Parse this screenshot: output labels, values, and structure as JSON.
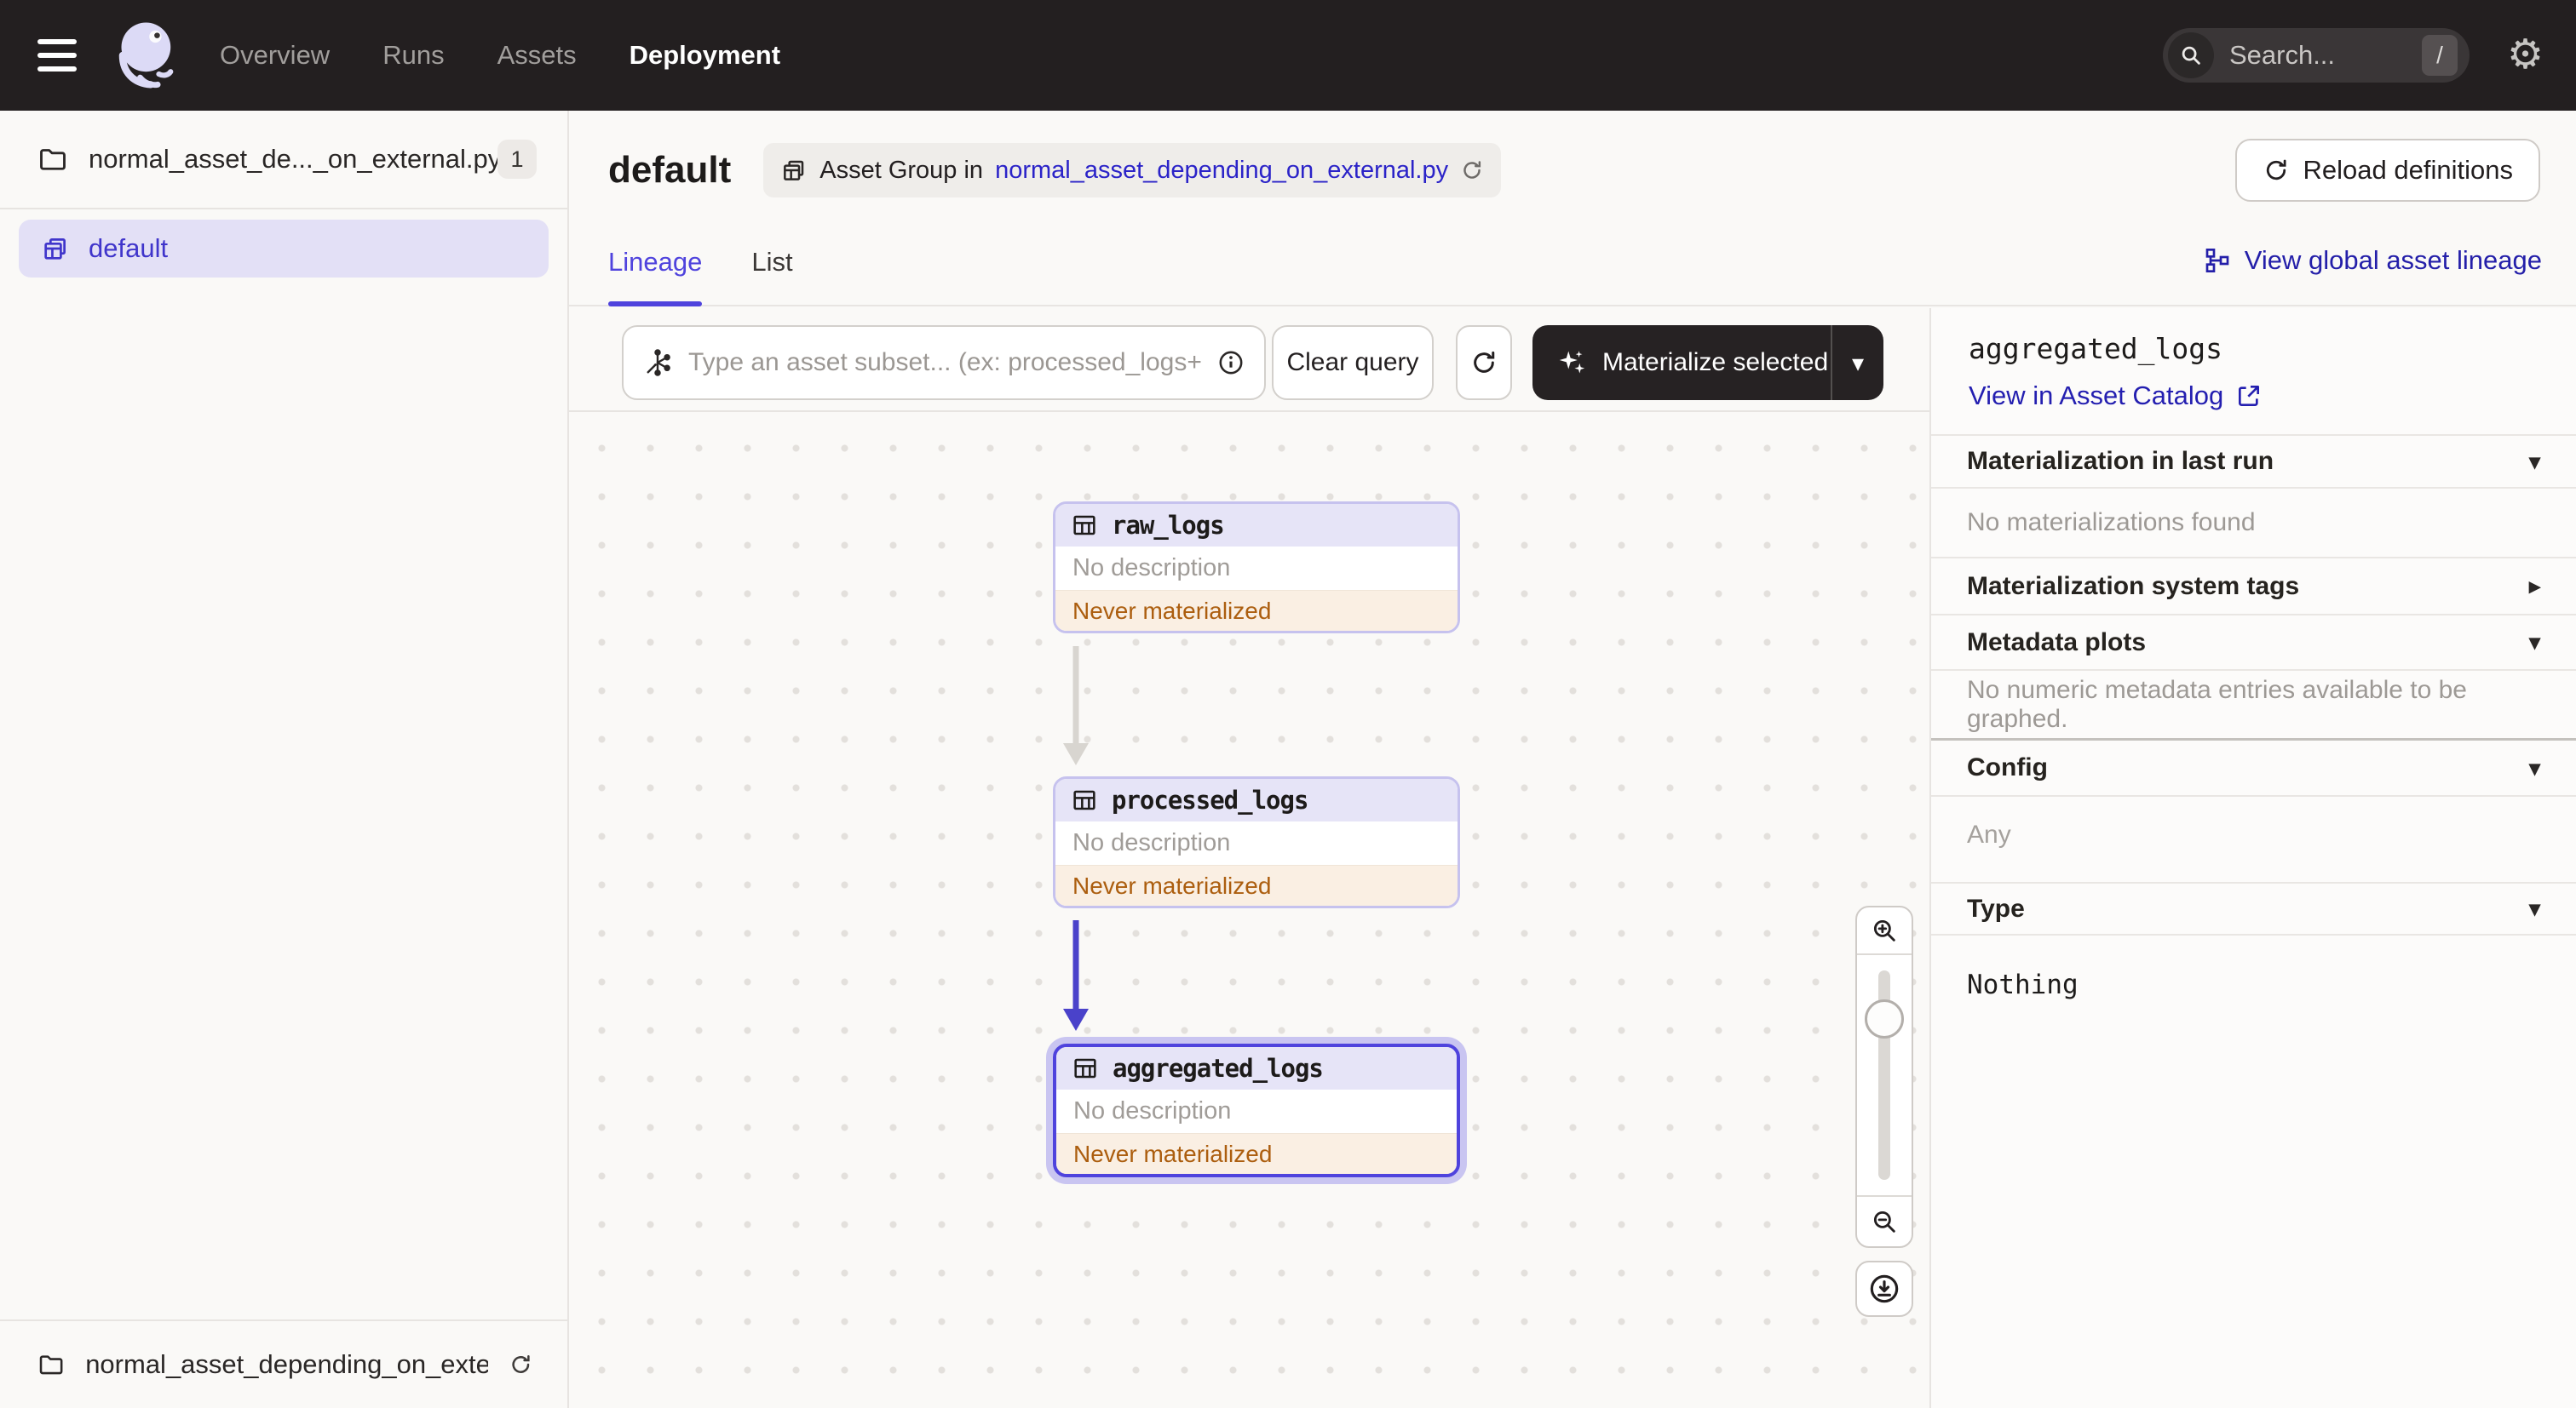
{
  "nav": {
    "items": [
      {
        "label": "Overview"
      },
      {
        "label": "Runs"
      },
      {
        "label": "Assets"
      },
      {
        "label": "Deployment",
        "active": true
      }
    ],
    "search": {
      "placeholder": "Search...",
      "shortcut": "/"
    }
  },
  "sidebar": {
    "repo": {
      "name": "normal_asset_de..._on_external.py",
      "badge": "1"
    },
    "group": {
      "label": "default",
      "selected": true
    },
    "footer": {
      "name": "normal_asset_depending_on_extern..."
    }
  },
  "header": {
    "title": "default",
    "chip_prefix": "Asset Group in",
    "chip_link": "normal_asset_depending_on_external.py",
    "reload_label": "Reload definitions"
  },
  "tabs": {
    "lineage": "Lineage",
    "list": "List",
    "active": "Lineage",
    "global_link": "View global asset lineage"
  },
  "toolbar": {
    "query_placeholder": "Type an asset subset... (ex: processed_logs+*)",
    "clear_label": "Clear query",
    "materialize_label": "Materialize selected"
  },
  "graph": {
    "nodes": [
      {
        "name": "raw_logs",
        "description": "No description",
        "status": "Never materialized",
        "selected": false
      },
      {
        "name": "processed_logs",
        "description": "No description",
        "status": "Never materialized",
        "selected": false
      },
      {
        "name": "aggregated_logs",
        "description": "No description",
        "status": "Never materialized",
        "selected": true
      }
    ],
    "edges": [
      {
        "from": "raw_logs",
        "to": "processed_logs",
        "highlighted": false
      },
      {
        "from": "processed_logs",
        "to": "aggregated_logs",
        "highlighted": true
      }
    ]
  },
  "details": {
    "title": "aggregated_logs",
    "catalog_link": "View in Asset Catalog",
    "sections": [
      {
        "label": "Materialization in last run",
        "body": "No materializations found"
      },
      {
        "label": "Materialization system tags"
      },
      {
        "label": "Metadata plots",
        "body": "No numeric metadata entries available to be graphed."
      },
      {
        "label": "Config",
        "body": "Any"
      },
      {
        "label": "Type",
        "body": "Nothing"
      }
    ]
  },
  "icons": {
    "caret_down": "▾",
    "caret_right": "▸",
    "gear": "⚙"
  },
  "colors": {
    "nav_bg": "#231F20",
    "accent": "#4F43DD",
    "link": "#2B23C8",
    "node_border": "#C6C2EE",
    "node_header_bg": "#E6E4F7",
    "status_bg": "#FAEFE3",
    "status_text": "#AC5E0F",
    "edge_default": "#D8D5D0",
    "edge_selected": "#4A42CA",
    "selected_halo": "#C9C5F1"
  }
}
